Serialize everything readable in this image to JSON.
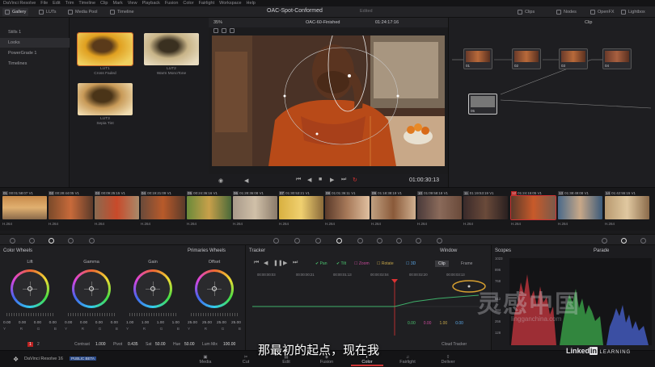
{
  "menu": [
    "DaVinci Resolve",
    "File",
    "Edit",
    "Trim",
    "Timeline",
    "Clip",
    "Mark",
    "View",
    "Playback",
    "Fusion",
    "Color",
    "Fairlight",
    "Workspace",
    "Help"
  ],
  "toolbar": {
    "gallery": "Gallery",
    "luts": "LUTs",
    "media_pool": "Media Pool",
    "timeline": "Timeline",
    "project_title": "OAC-Spot-Conformed",
    "project_status": "Edited",
    "clips": "Clips",
    "nodes": "Nodes",
    "openfx": "OpenFX",
    "lightbox": "Lightbox"
  },
  "albums": [
    "Stills 1",
    "Looks",
    "PowerGrade 1",
    "Timelines"
  ],
  "stills": [
    {
      "label1": "LUT1",
      "label2": "Cross Faded"
    },
    {
      "label1": "LUT2",
      "label2": "Warm MonoTone"
    },
    {
      "label1": "LUT3",
      "label2": "Sepia Tint"
    }
  ],
  "viewer": {
    "zoom": "35%",
    "timeline_name": "OAC-60-Finished",
    "timecode": "01:24:17:16",
    "clip_mode": "Clip",
    "playback_timecode": "01:00:30:13"
  },
  "nodes": [
    "01",
    "02",
    "03",
    "04",
    "05"
  ],
  "clips": [
    {
      "num": "01",
      "tc": "00:01:58:07",
      "track": "V1",
      "codec": "H.264"
    },
    {
      "num": "02",
      "tc": "00:28:44:05",
      "track": "V1",
      "codec": "H.264"
    },
    {
      "num": "03",
      "tc": "00:09:25:15",
      "track": "V1",
      "codec": "H.264"
    },
    {
      "num": "04",
      "tc": "00:19:21:09",
      "track": "V1",
      "codec": "H.264"
    },
    {
      "num": "05",
      "tc": "00:24:36:16",
      "track": "V1",
      "codec": "H.264"
    },
    {
      "num": "06",
      "tc": "01:28:36:08",
      "track": "V1",
      "codec": "H.264"
    },
    {
      "num": "07",
      "tc": "01:30:53:21",
      "track": "V1",
      "codec": "H.264"
    },
    {
      "num": "08",
      "tc": "01:01:36:11",
      "track": "V1",
      "codec": "H.264"
    },
    {
      "num": "09",
      "tc": "01:18:38:19",
      "track": "V1",
      "codec": "H.264"
    },
    {
      "num": "10",
      "tc": "01:09:58:18",
      "track": "V1",
      "codec": "H.264"
    },
    {
      "num": "11",
      "tc": "01:19:53:19",
      "track": "V1",
      "codec": "H.264"
    },
    {
      "num": "12",
      "tc": "01:24:15:05",
      "track": "V1",
      "codec": "H.264"
    },
    {
      "num": "13",
      "tc": "01:38:49:08",
      "track": "V1",
      "codec": "H.264"
    },
    {
      "num": "14",
      "tc": "01:42:55:15",
      "track": "V1",
      "codec": "H.264"
    }
  ],
  "color_wheels": {
    "title": "Color Wheels",
    "mode": "Primaries Wheels",
    "wheels": [
      {
        "name": "Lift",
        "values": [
          "0.00",
          "0.00",
          "0.00",
          "0.00"
        ]
      },
      {
        "name": "Gamma",
        "values": [
          "0.00",
          "0.00",
          "0.00",
          "0.00"
        ]
      },
      {
        "name": "Gain",
        "values": [
          "1.00",
          "1.00",
          "1.00",
          "1.00"
        ]
      },
      {
        "name": "Offset",
        "values": [
          "25.00",
          "25.00",
          "25.00",
          "25.00"
        ]
      }
    ],
    "channel_labels": [
      "Y",
      "R",
      "G",
      "B"
    ],
    "page_1": "1",
    "page_2": "2",
    "contrast_label": "Contrast",
    "contrast": "1.000",
    "pivot_label": "Pivot",
    "pivot": "0.435",
    "sat_label": "Sat",
    "sat": "50.00",
    "hue_label": "Hue",
    "hue": "50.00",
    "lummix_label": "Lum Mix",
    "lummix": "100.00"
  },
  "tracker": {
    "title": "Tracker",
    "mode": "Window",
    "pan": "Pan",
    "tilt": "Tilt",
    "zoom": "Zoom",
    "rotate": "Rotate",
    "three_d": "3D",
    "clip": "Clip",
    "frame": "Frame",
    "ruler": [
      "00:00:00:03",
      "00:00:00:21",
      "00:00:01:13",
      "00:00:02:04",
      "00:00:02:20",
      "00:00:03:13"
    ],
    "values": [
      "0.00",
      "0.00",
      "1.00",
      "0.00"
    ],
    "cloud": "Cloud Tracker"
  },
  "scopes": {
    "title": "Scopes",
    "mode": "Parade",
    "ticks": [
      "1023",
      "896",
      "768",
      "512",
      "384",
      "256",
      "128"
    ]
  },
  "bottom": {
    "app": "DaVinci Resolve 16",
    "beta": "PUBLIC BETA",
    "pages": [
      "Media",
      "Cut",
      "Edit",
      "Fusion",
      "Color",
      "Fairlight",
      "Deliver"
    ]
  },
  "subtitle": "那最初的起点，现在我",
  "watermark": "灵感中国",
  "watermark_url": "lingganchina.com",
  "linkedin": {
    "text": "Linked",
    "in": "in",
    "learning": "LEARNING"
  },
  "colors": {
    "accent_red": "#c33333",
    "tracker_green": "#3fb06a",
    "bg": "#1b1b1d"
  }
}
